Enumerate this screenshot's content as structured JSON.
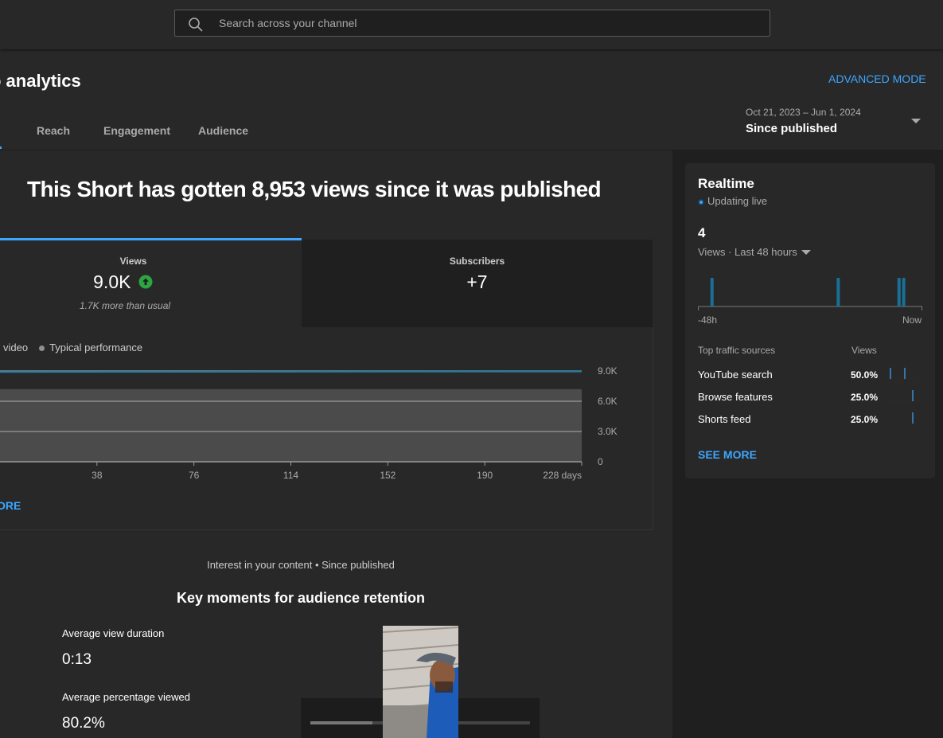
{
  "header": {
    "search_placeholder": "Search across your channel"
  },
  "page": {
    "title": "o analytics",
    "advanced_mode": "ADVANCED MODE"
  },
  "tabs": [
    {
      "label": "Reach"
    },
    {
      "label": "Engagement"
    },
    {
      "label": "Audience"
    }
  ],
  "date_picker": {
    "range": "Oct 21, 2023 – Jun 1, 2024",
    "preset": "Since published"
  },
  "overview": {
    "headline": "This Short has gotten 8,953 views since it was published",
    "views": {
      "label": "Views",
      "value": "9.0K",
      "note": "1.7K more than usual",
      "trend": "up"
    },
    "subscribers": {
      "label": "Subscribers",
      "value": "+7"
    },
    "legend": {
      "this_video": "video",
      "typical": "Typical performance"
    },
    "see_more": "ORE"
  },
  "chart_data": {
    "type": "line",
    "x_ticks": [
      "38",
      "76",
      "114",
      "152",
      "190",
      "228 days"
    ],
    "y_ticks": [
      "9.0K",
      "6.0K",
      "3.0K",
      "0"
    ],
    "ylim": [
      0,
      9000
    ],
    "series": [
      {
        "name": "video",
        "x": [
          0,
          228
        ],
        "values": [
          8900,
          8953
        ]
      }
    ],
    "typical_range": {
      "name": "Typical performance",
      "low": 0,
      "high": 7200
    },
    "grid": true
  },
  "retention": {
    "caption": "Interest in your content • Since published",
    "title": "Key moments for audience retention",
    "avg_duration_label": "Average view duration",
    "avg_duration": "0:13",
    "avg_pct_label": "Average percentage viewed",
    "avg_pct": "80.2%"
  },
  "realtime": {
    "title": "Realtime",
    "status": "Updating live",
    "count": "4",
    "metric": "Views · Last 48 hours",
    "axis_start": "-48h",
    "axis_end": "Now",
    "bar_hours_ago": [
      46,
      19,
      6,
      5
    ],
    "traffic_header": "Top traffic sources",
    "traffic_views_header": "Views",
    "sources": [
      {
        "name": "YouTube search",
        "pct": "50.0%",
        "share": 0.5
      },
      {
        "name": "Browse features",
        "pct": "25.0%",
        "share": 0.25
      },
      {
        "name": "Shorts feed",
        "pct": "25.0%",
        "share": 0.25
      }
    ],
    "see_more": "SEE MORE"
  },
  "colors": {
    "accent": "#3ea6ff",
    "trend_up": "#2ba640",
    "realtime_bar": "#1a6f97"
  }
}
